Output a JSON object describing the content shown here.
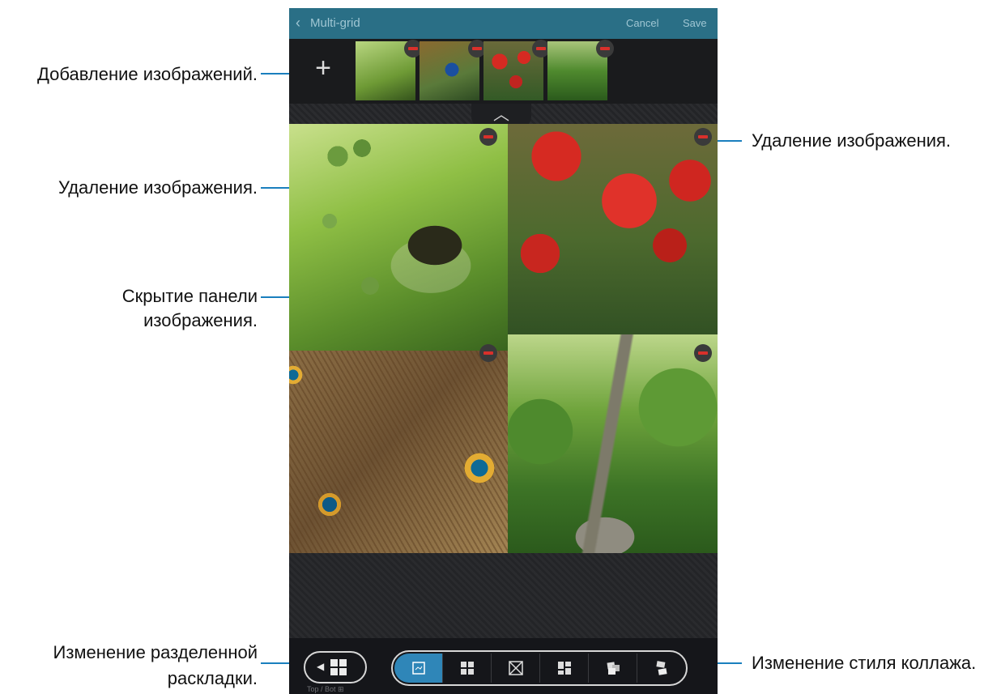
{
  "callouts": {
    "add_images": "Добавление изображений.",
    "delete_image_left": "Удаление изображения.",
    "delete_image_right": "Удаление изображения.",
    "hide_panel": "Скрытие панели изображения.",
    "hide_panel_line1": "Скрытие панели",
    "hide_panel_line2": "изображения.",
    "change_split_line1": "Изменение разделенной",
    "change_split_line2": "раскладки.",
    "change_style": "Изменение стиля коллажа."
  },
  "titlebar": {
    "back_icon": "chevron-left-icon",
    "title": "Multi-grid",
    "cancel": "Cancel",
    "save": "Save",
    "color": "#2a6f86"
  },
  "thumbnails": [
    "bee",
    "peacock",
    "poppies",
    "garden-path"
  ],
  "add_icon": "+",
  "collapse_icon": "︿",
  "split_layout": {
    "label": "Top / Bot  ⊞"
  },
  "style_options": [
    {
      "name": "style-1",
      "selected": true
    },
    {
      "name": "style-grid",
      "selected": false
    },
    {
      "name": "style-diagonal",
      "selected": false
    },
    {
      "name": "style-offset",
      "selected": false
    },
    {
      "name": "style-stack",
      "selected": false
    },
    {
      "name": "style-scatter",
      "selected": false
    }
  ],
  "colors": {
    "callout_line": "#1a7fbe",
    "delete_red": "#d9302b",
    "selected_style": "#2f86b8"
  }
}
